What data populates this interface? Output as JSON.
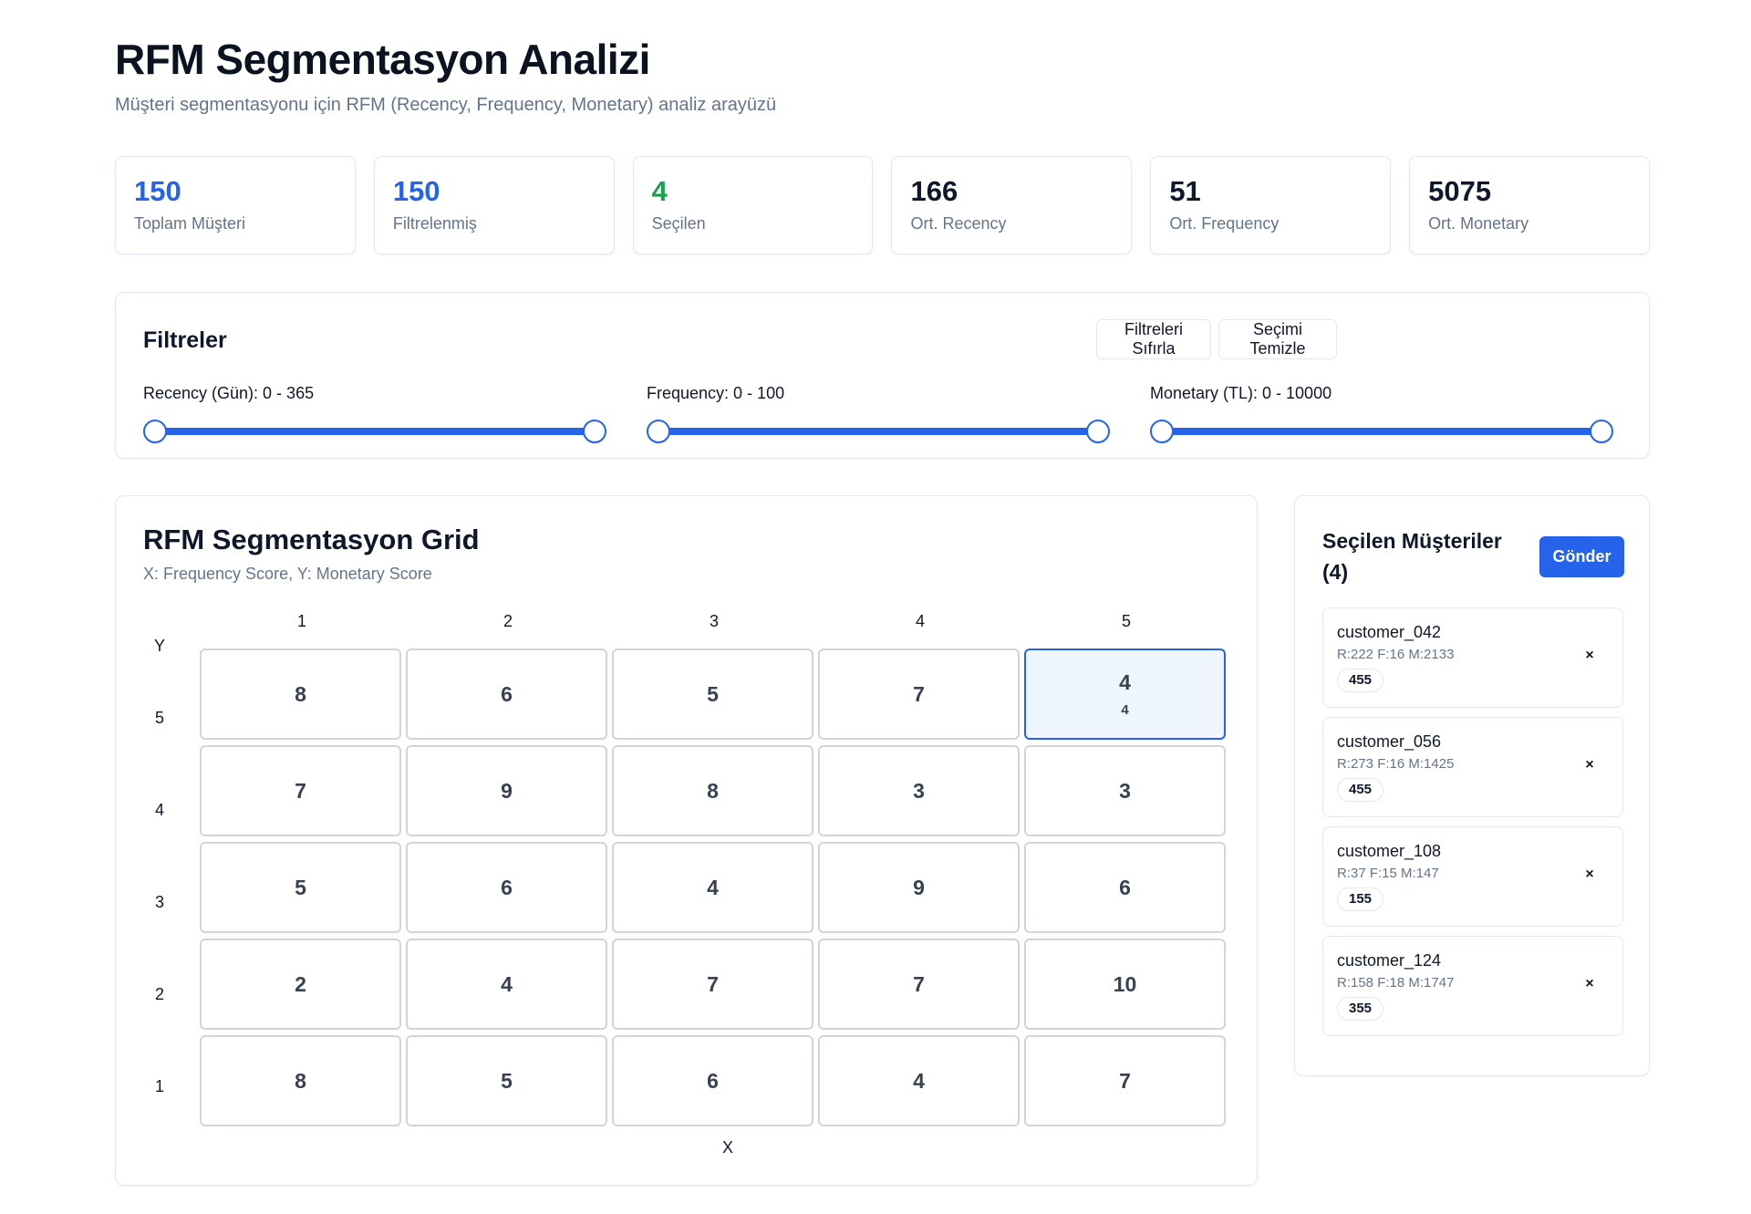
{
  "header": {
    "title": "RFM Segmentasyon Analizi",
    "subtitle": "Müşteri segmentasyonu için RFM (Recency, Frequency, Monetary) analiz arayüzü"
  },
  "stats": [
    {
      "value": "150",
      "label": "Toplam Müşteri",
      "color": "#2563eb"
    },
    {
      "value": "150",
      "label": "Filtrelenmiş",
      "color": "#2563eb"
    },
    {
      "value": "4",
      "label": "Seçilen",
      "color": "#16a34a"
    },
    {
      "value": "166",
      "label": "Ort. Recency",
      "color": "#0f172a"
    },
    {
      "value": "51",
      "label": "Ort. Frequency",
      "color": "#0f172a"
    },
    {
      "value": "5075",
      "label": "Ort. Monetary",
      "color": "#0f172a"
    }
  ],
  "filters": {
    "title": "Filtreler",
    "reset_label": "Filtreleri Sıfırla",
    "clear_label": "Seçimi Temizle",
    "sliders": [
      {
        "label": "Recency (Gün): 0 - 365",
        "min": 0,
        "max": 365,
        "low": 0,
        "high": 365
      },
      {
        "label": "Frequency: 0 - 100",
        "min": 0,
        "max": 100,
        "low": 0,
        "high": 100
      },
      {
        "label": "Monetary (TL): 0 - 10000",
        "min": 0,
        "max": 10000,
        "low": 0,
        "high": 10000
      }
    ]
  },
  "grid": {
    "title": "RFM Segmentasyon Grid",
    "subtitle": "X: Frequency Score, Y: Monetary Score",
    "y_title": "Y",
    "x_title": "X",
    "columns": [
      "1",
      "2",
      "3",
      "4",
      "5"
    ],
    "rows": [
      {
        "label": "5",
        "cells": [
          {
            "count": "8"
          },
          {
            "count": "6"
          },
          {
            "count": "5"
          },
          {
            "count": "7"
          },
          {
            "count": "4",
            "selected": "4"
          }
        ]
      },
      {
        "label": "4",
        "cells": [
          {
            "count": "7"
          },
          {
            "count": "9"
          },
          {
            "count": "8"
          },
          {
            "count": "3"
          },
          {
            "count": "3"
          }
        ]
      },
      {
        "label": "3",
        "cells": [
          {
            "count": "5"
          },
          {
            "count": "6"
          },
          {
            "count": "4"
          },
          {
            "count": "9"
          },
          {
            "count": "6"
          }
        ]
      },
      {
        "label": "2",
        "cells": [
          {
            "count": "2"
          },
          {
            "count": "4"
          },
          {
            "count": "7"
          },
          {
            "count": "7"
          },
          {
            "count": "10"
          }
        ]
      },
      {
        "label": "1",
        "cells": [
          {
            "count": "8"
          },
          {
            "count": "5"
          },
          {
            "count": "6"
          },
          {
            "count": "4"
          },
          {
            "count": "7"
          }
        ]
      }
    ]
  },
  "selected": {
    "title": "Seçilen Müşteriler (4)",
    "send_label": "Gönder",
    "remove_glyph": "×",
    "customers": [
      {
        "id": "customer_042",
        "meta": "R:222 F:16 M:2133",
        "score": "455"
      },
      {
        "id": "customer_056",
        "meta": "R:273 F:16 M:1425",
        "score": "455"
      },
      {
        "id": "customer_108",
        "meta": "R:37 F:15 M:147",
        "score": "155"
      },
      {
        "id": "customer_124",
        "meta": "R:158 F:18 M:1747",
        "score": "355"
      }
    ]
  }
}
